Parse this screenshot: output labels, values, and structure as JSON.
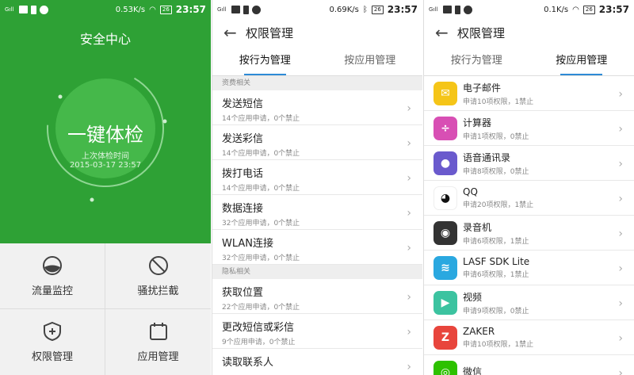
{
  "status_bars": [
    {
      "speed": "0.53K/s",
      "battery": "26",
      "time": "23:57"
    },
    {
      "speed": "0.69K/s",
      "battery": "26",
      "time": "23:57"
    },
    {
      "speed": "0.1K/s",
      "battery": "26",
      "time": "23:57"
    }
  ],
  "security_center": {
    "title": "安全中心",
    "check_button": "一键体检",
    "last_check_label": "上次体检时间",
    "last_check_date": "2015-03-17 23:57",
    "tiles": [
      {
        "label": "流量监控",
        "icon": "traffic-icon"
      },
      {
        "label": "骚扰拦截",
        "icon": "block-icon"
      },
      {
        "label": "权限管理",
        "icon": "shield-plus-icon"
      },
      {
        "label": "应用管理",
        "icon": "calendar-icon"
      }
    ]
  },
  "permissions_by_behavior": {
    "title": "权限管理",
    "tabs": [
      "按行为管理",
      "按应用管理"
    ],
    "active_tab": 0,
    "sections": [
      {
        "header": "资费相关",
        "items": [
          {
            "title": "发送短信",
            "sub": "14个应用申请，0个禁止"
          },
          {
            "title": "发送彩信",
            "sub": "14个应用申请，0个禁止"
          },
          {
            "title": "拨打电话",
            "sub": "14个应用申请，0个禁止"
          },
          {
            "title": "数据连接",
            "sub": "32个应用申请，0个禁止"
          },
          {
            "title": "WLAN连接",
            "sub": "32个应用申请，0个禁止"
          }
        ]
      },
      {
        "header": "隐私相关",
        "items": [
          {
            "title": "获取位置",
            "sub": "22个应用申请，0个禁止"
          },
          {
            "title": "更改短信或彩信",
            "sub": "9个应用申请，0个禁止"
          },
          {
            "title": "读取联系人",
            "sub": ""
          }
        ]
      }
    ]
  },
  "permissions_by_app": {
    "title": "权限管理",
    "tabs": [
      "按行为管理",
      "按应用管理"
    ],
    "active_tab": 1,
    "apps": [
      {
        "name": "电子邮件",
        "sub": "申请10项权限，1禁止",
        "icon": "email-icon",
        "color": "#f5c518"
      },
      {
        "name": "计算器",
        "sub": "申请1项权限，0禁止",
        "icon": "calculator-icon",
        "color": "#d84fb4"
      },
      {
        "name": "语音通讯录",
        "sub": "申请8项权限，0禁止",
        "icon": "microphone-icon",
        "color": "#6a5acd"
      },
      {
        "name": "QQ",
        "sub": "申请20项权限，1禁止",
        "icon": "qq-penguin-icon",
        "color": "#ffffff"
      },
      {
        "name": "录音机",
        "sub": "申请6项权限，1禁止",
        "icon": "recorder-icon",
        "color": "#333333"
      },
      {
        "name": "LASF SDK Lite",
        "sub": "申请6项权限，1禁止",
        "icon": "waveform-icon",
        "color": "#2aa8e0"
      },
      {
        "name": "视频",
        "sub": "申请9项权限，0禁止",
        "icon": "play-icon",
        "color": "#3cc3a0"
      },
      {
        "name": "ZAKER",
        "sub": "申请10项权限，1禁止",
        "icon": "zaker-icon",
        "color": "#e8453c"
      },
      {
        "name": "微信",
        "sub": "",
        "icon": "wechat-icon",
        "color": "#2dc100"
      }
    ]
  }
}
